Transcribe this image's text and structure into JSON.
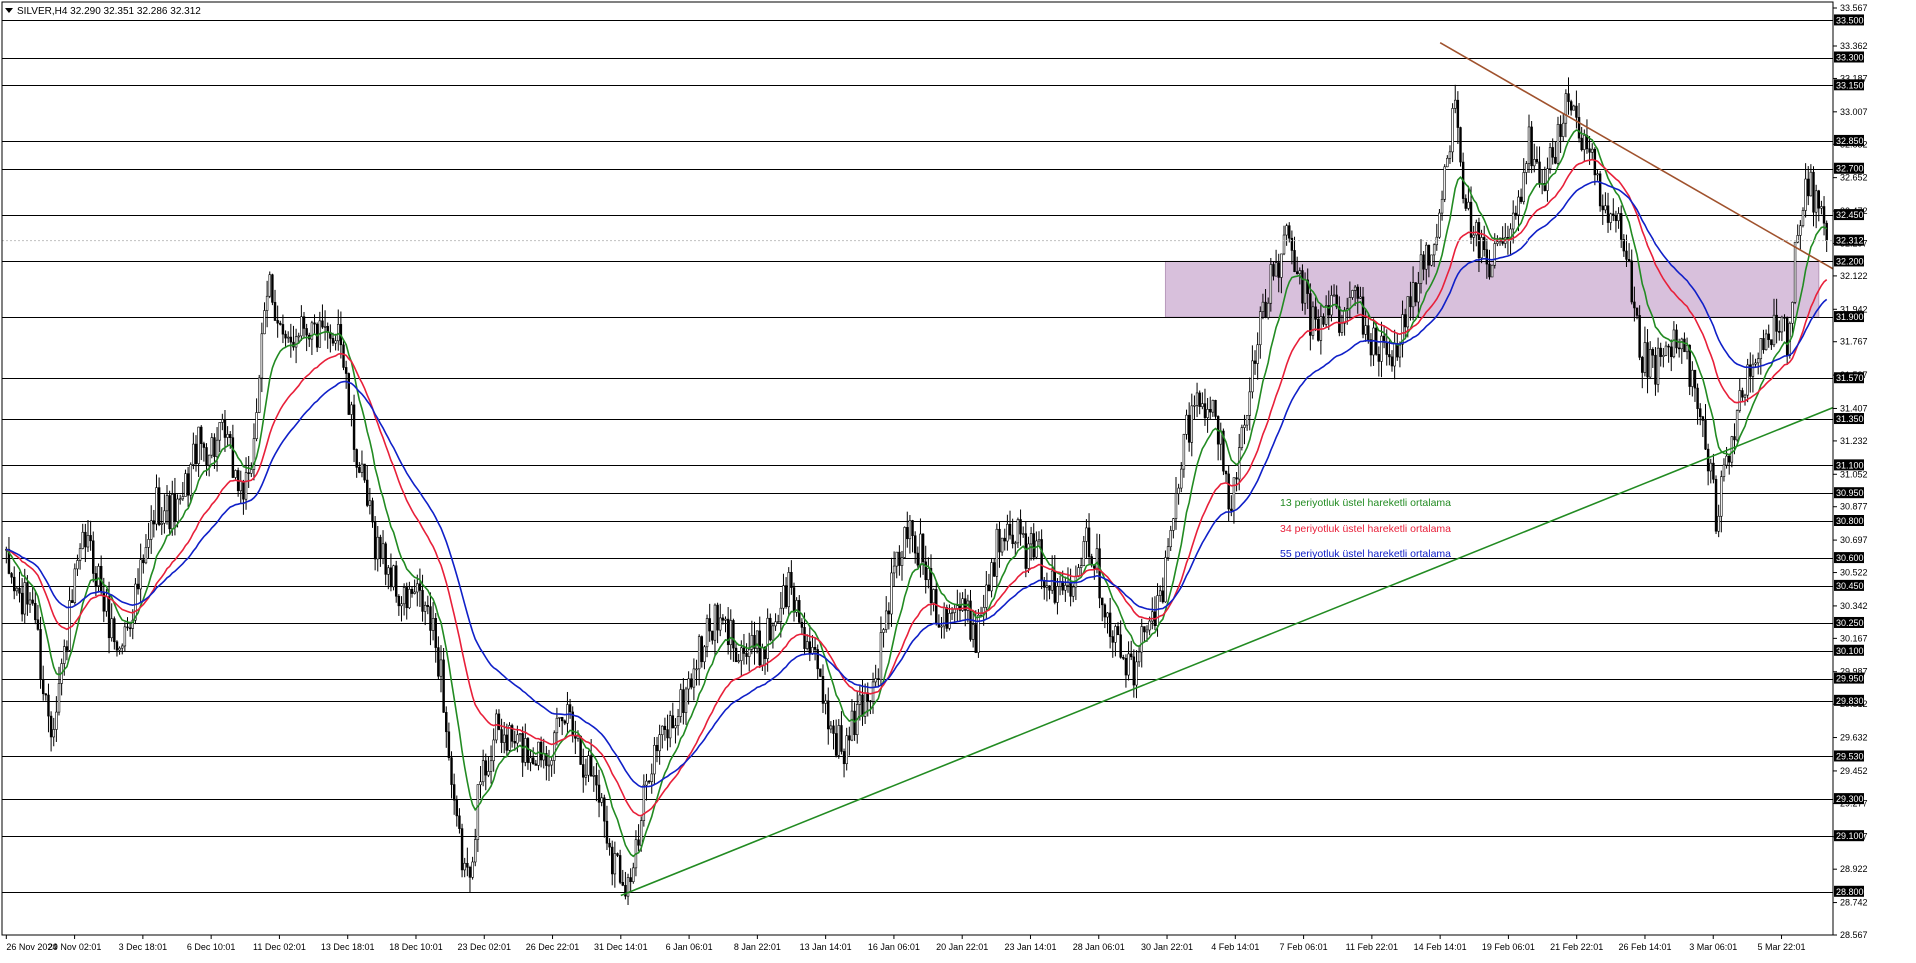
{
  "header": {
    "symbol_label": "SILVER,H4  32.290 32.351 32.286 32.312"
  },
  "legend": [
    {
      "label": "13 periyotluk üstel hareketli ortalama",
      "color": "#228b22"
    },
    {
      "label": "34 periyotluk üstel hareketli ortalama",
      "color": "#e8203a"
    },
    {
      "label": "55 periyotluk üstel hareketli ortalama",
      "color": "#1020c8"
    }
  ],
  "chart_data": {
    "type": "candlestick",
    "symbol": "SILVER",
    "timeframe": "H4",
    "ohlc_current": {
      "open": 32.29,
      "high": 32.351,
      "low": 32.286,
      "close": 32.312
    },
    "current_price_label": "32.312",
    "ylim": [
      28.567,
      33.567
    ],
    "y_tick_labels": [
      "33.567",
      "33.362",
      "33.187",
      "33.007",
      "32.832",
      "32.652",
      "32.472",
      "32.297",
      "32.122",
      "31.942",
      "31.767",
      "31.587",
      "31.407",
      "31.232",
      "31.052",
      "30.877",
      "30.697",
      "30.522",
      "30.342",
      "30.167",
      "29.987",
      "29.812",
      "29.632",
      "29.452",
      "29.277",
      "29.097",
      "28.922",
      "28.742",
      "28.567"
    ],
    "x_tick_labels": [
      "26 Nov 2024",
      "29 Nov 02:01",
      "3 Dec 18:01",
      "6 Dec 10:01",
      "11 Dec 02:01",
      "13 Dec 18:01",
      "18 Dec 10:01",
      "23 Dec 02:01",
      "26 Dec 22:01",
      "31 Dec 14:01",
      "6 Jan 06:01",
      "8 Jan 22:01",
      "13 Jan 14:01",
      "16 Jan 06:01",
      "20 Jan 22:01",
      "23 Jan 14:01",
      "28 Jan 06:01",
      "30 Jan 22:01",
      "4 Feb 14:01",
      "7 Feb 06:01",
      "11 Feb 22:01",
      "14 Feb 14:01",
      "19 Feb 06:01",
      "21 Feb 22:01",
      "26 Feb 14:01",
      "3 Mar 06:01",
      "5 Mar 22:01"
    ],
    "horizontal_levels": [
      33.5,
      33.3,
      33.15,
      32.85,
      32.7,
      32.45,
      32.2,
      31.9,
      31.57,
      31.35,
      31.1,
      30.95,
      30.8,
      30.6,
      30.45,
      30.25,
      30.1,
      29.95,
      29.83,
      29.53,
      29.3,
      29.1,
      28.8
    ],
    "horizontal_level_labels": [
      "33.500",
      "33.300",
      "33.150",
      "32.850",
      "32.700",
      "32.450",
      "32.200",
      "31.900",
      "31.570",
      "31.350",
      "31.100",
      "30.950",
      "30.800",
      "30.600",
      "30.450",
      "30.250",
      "30.100",
      "29.950",
      "29.830",
      "29.530",
      "29.300",
      "29.100",
      "28.800"
    ],
    "zone": {
      "from": 31.9,
      "to": 32.2,
      "color": "#d8c0dc"
    },
    "trendlines": [
      {
        "color": "#a0522d",
        "from": {
          "x": "14 Feb 14:01",
          "y": 33.38
        },
        "to": {
          "x": "5 Mar 22:01",
          "y": 32.32
        }
      },
      {
        "color": "#228b22",
        "from": {
          "x": "31 Dec 14:01",
          "y": 28.78
        },
        "to": {
          "x": "5 Mar 22:01",
          "y": 31.3
        }
      }
    ],
    "price_anchors": [
      [
        0,
        30.55
      ],
      [
        6,
        30.35
      ],
      [
        10,
        30.4
      ],
      [
        14,
        29.9
      ],
      [
        17,
        29.7
      ],
      [
        21,
        30.0
      ],
      [
        26,
        30.45
      ],
      [
        30,
        30.7
      ],
      [
        35,
        30.5
      ],
      [
        38,
        30.3
      ],
      [
        43,
        30.1
      ],
      [
        48,
        30.35
      ],
      [
        53,
        30.6
      ],
      [
        57,
        30.9
      ],
      [
        62,
        30.85
      ],
      [
        66,
        30.85
      ],
      [
        72,
        31.2
      ],
      [
        78,
        31.2
      ],
      [
        83,
        31.25
      ],
      [
        88,
        31.0
      ],
      [
        92,
        30.95
      ],
      [
        96,
        31.6
      ],
      [
        100,
        32.1
      ],
      [
        106,
        31.7
      ],
      [
        112,
        31.9
      ],
      [
        118,
        31.8
      ],
      [
        123,
        31.75
      ],
      [
        126,
        31.9
      ],
      [
        130,
        31.4
      ],
      [
        135,
        31.0
      ],
      [
        140,
        30.7
      ],
      [
        145,
        30.55
      ],
      [
        150,
        30.35
      ],
      [
        155,
        30.4
      ],
      [
        160,
        30.3
      ],
      [
        165,
        30.0
      ],
      [
        170,
        29.2
      ],
      [
        175,
        28.85
      ],
      [
        180,
        29.4
      ],
      [
        186,
        29.65
      ],
      [
        193,
        29.6
      ],
      [
        200,
        29.55
      ],
      [
        208,
        29.6
      ],
      [
        214,
        29.8
      ],
      [
        218,
        29.55
      ],
      [
        224,
        29.4
      ],
      [
        230,
        29.0
      ],
      [
        236,
        28.85
      ],
      [
        240,
        29.05
      ],
      [
        244,
        29.5
      ],
      [
        250,
        29.65
      ],
      [
        256,
        29.8
      ],
      [
        262,
        30.05
      ],
      [
        268,
        30.25
      ],
      [
        274,
        30.2
      ],
      [
        280,
        30.1
      ],
      [
        286,
        30.1
      ],
      [
        291,
        30.25
      ],
      [
        297,
        30.45
      ],
      [
        303,
        30.2
      ],
      [
        308,
        29.95
      ],
      [
        313,
        29.7
      ],
      [
        318,
        29.55
      ],
      [
        324,
        29.8
      ],
      [
        330,
        29.95
      ],
      [
        336,
        30.45
      ],
      [
        342,
        30.75
      ],
      [
        348,
        30.6
      ],
      [
        354,
        30.3
      ],
      [
        359,
        30.35
      ],
      [
        364,
        30.3
      ],
      [
        368,
        30.2
      ],
      [
        374,
        30.55
      ],
      [
        380,
        30.85
      ],
      [
        386,
        30.65
      ],
      [
        392,
        30.6
      ],
      [
        398,
        30.4
      ],
      [
        404,
        30.5
      ],
      [
        410,
        30.75
      ],
      [
        414,
        30.55
      ],
      [
        418,
        30.3
      ],
      [
        424,
        30.05
      ],
      [
        428,
        29.95
      ],
      [
        433,
        30.3
      ],
      [
        438,
        30.35
      ],
      [
        442,
        30.7
      ],
      [
        448,
        31.3
      ],
      [
        454,
        31.5
      ],
      [
        460,
        31.3
      ],
      [
        465,
        30.85
      ],
      [
        470,
        31.4
      ],
      [
        475,
        31.75
      ],
      [
        480,
        32.1
      ],
      [
        486,
        32.3
      ],
      [
        492,
        32.05
      ],
      [
        497,
        31.8
      ],
      [
        502,
        32.0
      ],
      [
        507,
        31.85
      ],
      [
        512,
        32.05
      ],
      [
        518,
        31.75
      ],
      [
        524,
        31.7
      ],
      [
        528,
        31.75
      ],
      [
        532,
        31.95
      ],
      [
        537,
        32.15
      ],
      [
        542,
        32.25
      ],
      [
        546,
        32.65
      ],
      [
        550,
        33.15
      ],
      [
        554,
        32.45
      ],
      [
        558,
        32.35
      ],
      [
        562,
        32.1
      ],
      [
        568,
        32.3
      ],
      [
        574,
        32.45
      ],
      [
        578,
        32.85
      ],
      [
        584,
        32.65
      ],
      [
        590,
        32.9
      ],
      [
        594,
        33.1
      ],
      [
        598,
        32.85
      ],
      [
        602,
        32.7
      ],
      [
        606,
        32.45
      ],
      [
        612,
        32.35
      ],
      [
        616,
        32.1
      ],
      [
        620,
        31.7
      ],
      [
        626,
        31.6
      ],
      [
        632,
        31.75
      ],
      [
        638,
        31.7
      ],
      [
        642,
        31.4
      ],
      [
        646,
        31.1
      ],
      [
        649,
        30.85
      ],
      [
        653,
        31.15
      ],
      [
        657,
        31.35
      ],
      [
        662,
        31.6
      ],
      [
        667,
        31.75
      ],
      [
        672,
        31.85
      ],
      [
        676,
        31.8
      ],
      [
        680,
        32.35
      ],
      [
        684,
        32.6
      ],
      [
        688,
        32.5
      ],
      [
        691,
        32.31
      ]
    ],
    "series": [
      {
        "name": "13 periyotluk üstel hareketli ortalama",
        "type": "ema",
        "period": 13,
        "color": "#228b22"
      },
      {
        "name": "34 periyotluk üstel hareketli ortalama",
        "type": "ema",
        "period": 34,
        "color": "#e8203a"
      },
      {
        "name": "55 periyotluk üstel hareketli ortalama",
        "type": "ema",
        "period": 55,
        "color": "#1020c8"
      }
    ]
  }
}
